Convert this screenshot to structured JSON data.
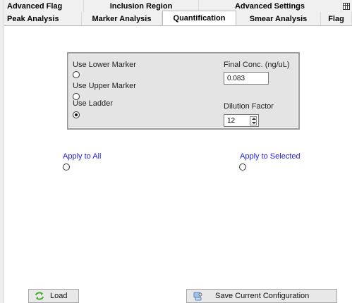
{
  "tabs": {
    "row1": [
      {
        "label": "Advanced Flag"
      },
      {
        "label": "Inclusion Region"
      },
      {
        "label": "Advanced Settings"
      }
    ],
    "row2": [
      {
        "label": "Peak Analysis"
      },
      {
        "label": "Marker Analysis"
      },
      {
        "label": "Quantification",
        "active": true
      },
      {
        "label": "Smear Analysis"
      },
      {
        "label": "Flag"
      }
    ],
    "row1_end_icon": "grid-icon"
  },
  "quant": {
    "lower_marker_label": "Use Lower Marker",
    "upper_marker_label": "Use Upper Marker",
    "ladder_label": "Use Ladder",
    "selected": "ladder",
    "final_conc_label": "Final Conc. (ng/uL)",
    "final_conc_value": "0.083",
    "dilution_label": "Dilution Factor",
    "dilution_value": "12"
  },
  "apply": {
    "all_label": "Apply to All",
    "selected_label": "Apply to Selected"
  },
  "buttons": {
    "load_label": "Load",
    "load_icon": "reload-icon",
    "save_label": "Save Current Configuration",
    "save_icon": "save-config-icon"
  },
  "colors": {
    "link": "#2222dd",
    "panel": "#e4e4e4",
    "reload_green": "#4cab2e"
  }
}
